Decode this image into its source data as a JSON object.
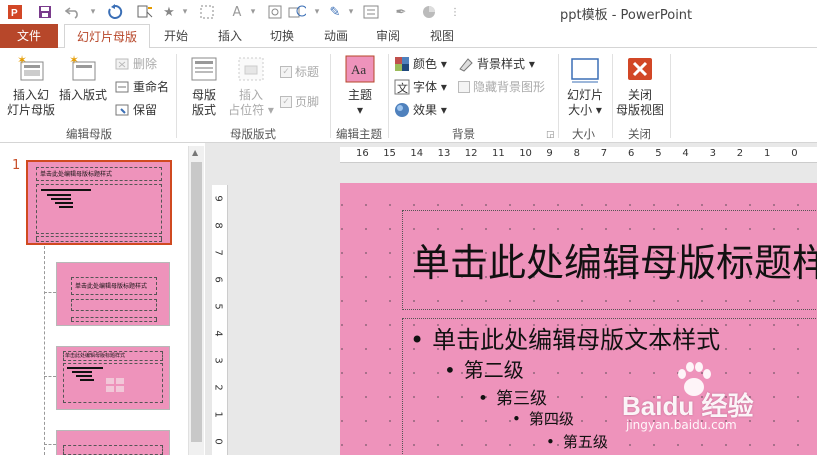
{
  "window": {
    "title": "ppt模板 - PowerPoint"
  },
  "qat": {
    "icons": [
      "powerpoint-logo-icon",
      "save-icon",
      "undo-icon",
      "redo-icon",
      "start-from-beginning-icon",
      "star-icon",
      "select-icon",
      "font-icon",
      "shapes-icon",
      "arrange-icon",
      "text-color-icon",
      "textbox-icon",
      "eyedropper-icon",
      "fill-icon",
      "more-icon"
    ]
  },
  "tabs": [
    {
      "label": "文件"
    },
    {
      "label": "幻灯片母版"
    },
    {
      "label": "开始"
    },
    {
      "label": "插入"
    },
    {
      "label": "切换"
    },
    {
      "label": "动画"
    },
    {
      "label": "审阅"
    },
    {
      "label": "视图"
    }
  ],
  "ribbon": {
    "groups": {
      "edit_master": "编辑母版",
      "master_layout": "母版版式",
      "edit_theme": "编辑主题",
      "background": "背景",
      "size": "大小",
      "close": "关闭"
    },
    "insert_slide_master": {
      "line1": "插入幻",
      "line2": "灯片母版"
    },
    "insert_layout": "插入版式",
    "delete": "删除",
    "rename": "重命名",
    "preserve": "保留",
    "master_layout_btn": {
      "line1": "母版",
      "line2": "版式"
    },
    "insert_placeholder": {
      "line1": "插入",
      "line2": "占位符 ▾"
    },
    "title_check": "标题",
    "footer_check": "页脚",
    "themes": {
      "line1": "主题",
      "line2": "▾"
    },
    "colors": "颜色 ▾",
    "fonts": "字体 ▾",
    "effects": "效果 ▾",
    "background_styles": "背景样式 ▾",
    "hide_bg": "隐藏背景图形",
    "slide_size": {
      "line1": "幻灯片",
      "line2": "大小 ▾"
    },
    "close_master": {
      "line1": "关闭",
      "line2": "母版视图"
    }
  },
  "thumbnails": {
    "number": "1",
    "thumb1_title": "单击此处编辑母版标题样式",
    "thumb2_title": "单击此处编辑母版标题样式",
    "thumb3_title": "单击此处编辑母版标题样式"
  },
  "ruler": {
    "h": [
      "16",
      "15",
      "14",
      "13",
      "12",
      "11",
      "10",
      "9",
      "8",
      "7",
      "6",
      "5",
      "4",
      "3",
      "2",
      "1",
      "0"
    ],
    "v": [
      "9",
      "8",
      "7",
      "6",
      "5",
      "4",
      "3",
      "2",
      "1",
      "0"
    ]
  },
  "slide": {
    "title": "单击此处编辑母版标题样式",
    "levels": [
      "单击此处编辑母版文本样式",
      "第二级",
      "第三级",
      "第四级",
      "第五级"
    ],
    "bullet": "•"
  },
  "watermark": {
    "brand": "Baidu 经验",
    "url": "jingyan.baidu.com"
  }
}
